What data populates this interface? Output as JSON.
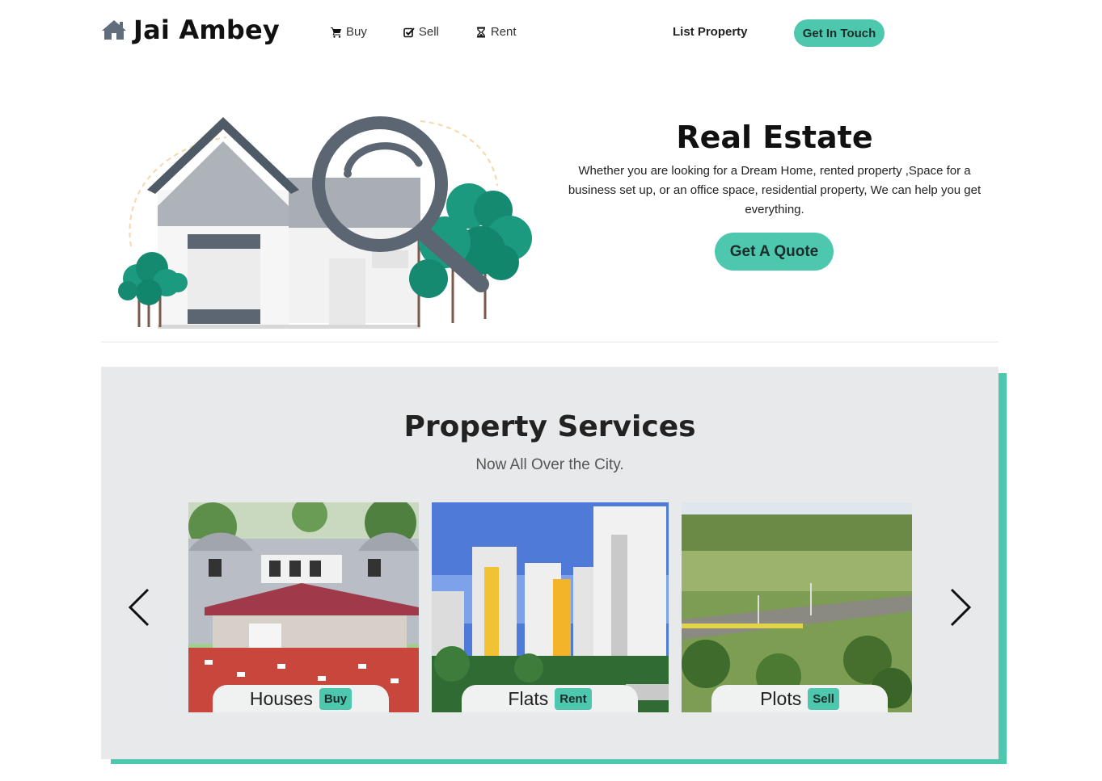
{
  "navbar": {
    "brand": "Jai Ambey",
    "links": [
      {
        "label": "Buy",
        "icon": "cart-icon"
      },
      {
        "label": "Sell",
        "icon": "check-square-icon"
      },
      {
        "label": "Rent",
        "icon": "hourglass-icon"
      }
    ],
    "list_property": "List Property",
    "get_in_touch": "Get In Touch"
  },
  "hero": {
    "title": "Real Estate",
    "description": "Whether you are looking for a Dream Home, rented property ,Space for a business set up, or an office space, residential property, We can help you get everything.",
    "cta": "Get A Quote"
  },
  "services": {
    "title": "Property Services",
    "subtitle": "Now All Over the City.",
    "cards": [
      {
        "name": "Houses",
        "badge": "Buy"
      },
      {
        "name": "Flats",
        "badge": "Rent"
      },
      {
        "name": "Plots",
        "badge": "Sell"
      }
    ]
  },
  "colors": {
    "accent": "#4dc7ae",
    "section_bg": "#e8e9ea",
    "house_dark": "#4e5a66",
    "tree_green": "#1b9a80"
  }
}
